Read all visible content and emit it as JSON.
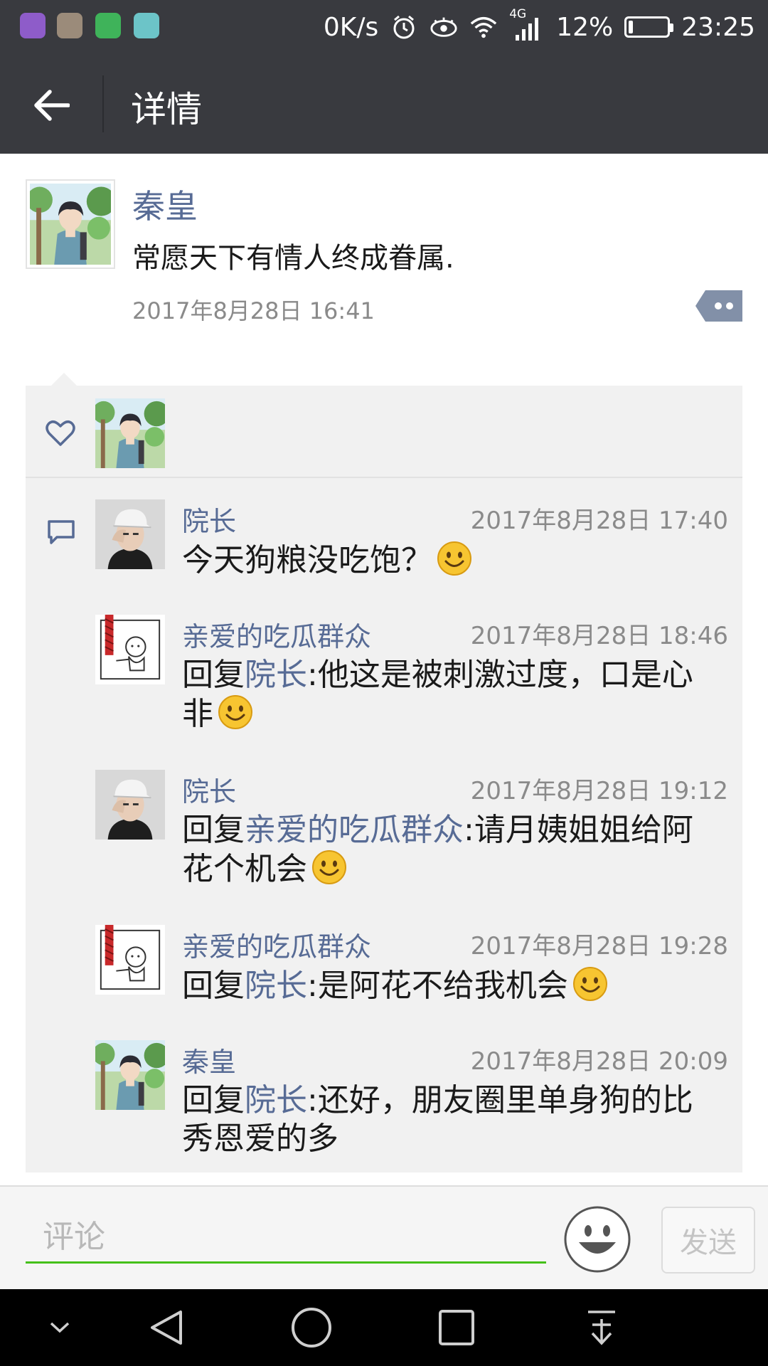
{
  "status_bar": {
    "speed": "0K/s",
    "network": "4G",
    "battery": "12%",
    "battery_level": 0.12,
    "time": "23:25"
  },
  "header": {
    "title": "详情"
  },
  "post": {
    "author": "秦皇",
    "text": "常愿天下有情人终成眷属.",
    "time": "2017年8月28日 16:41"
  },
  "comments": [
    {
      "name": "院长",
      "time": "2017年8月28日 17:40",
      "text": "今天狗粮没吃饱？",
      "reply_prefix": "",
      "reply_to": "",
      "avatar": "院长"
    },
    {
      "name": "亲爱的吃瓜群众",
      "time": "2017年8月28日 18:46",
      "reply_prefix": "回复",
      "reply_to": "院长",
      "text": ":他这是被刺激过度，口是心非",
      "avatar": "亲爱的吃瓜群众"
    },
    {
      "name": "院长",
      "time": "2017年8月28日 19:12",
      "reply_prefix": "回复",
      "reply_to": "亲爱的吃瓜群众",
      "text": ":请月姨姐姐给阿花个机会",
      "avatar": "院长"
    },
    {
      "name": "亲爱的吃瓜群众",
      "time": "2017年8月28日 19:28",
      "reply_prefix": "回复",
      "reply_to": "院长",
      "text": ":是阿花不给我机会",
      "avatar": "亲爱的吃瓜群众"
    },
    {
      "name": "秦皇",
      "time": "2017年8月28日 20:09",
      "reply_prefix": "回复",
      "reply_to": "院长",
      "text": ":还好，朋友圈里单身狗的比秀恩爱的多",
      "avatar": "秦皇"
    }
  ],
  "input_bar": {
    "placeholder": "评论",
    "send_label": "发送"
  },
  "colors": {
    "bar_background": "#393a3f",
    "name_link": "#576b95",
    "input_underline": "#45c01a",
    "panel_background": "#f1f1f1"
  },
  "icons": [
    "back-arrow-icon",
    "heart-icon",
    "comment-icon",
    "more-icon",
    "emoji-icon",
    "alarm-icon",
    "eye-icon",
    "wifi-icon",
    "signal-icon",
    "battery-icon"
  ]
}
